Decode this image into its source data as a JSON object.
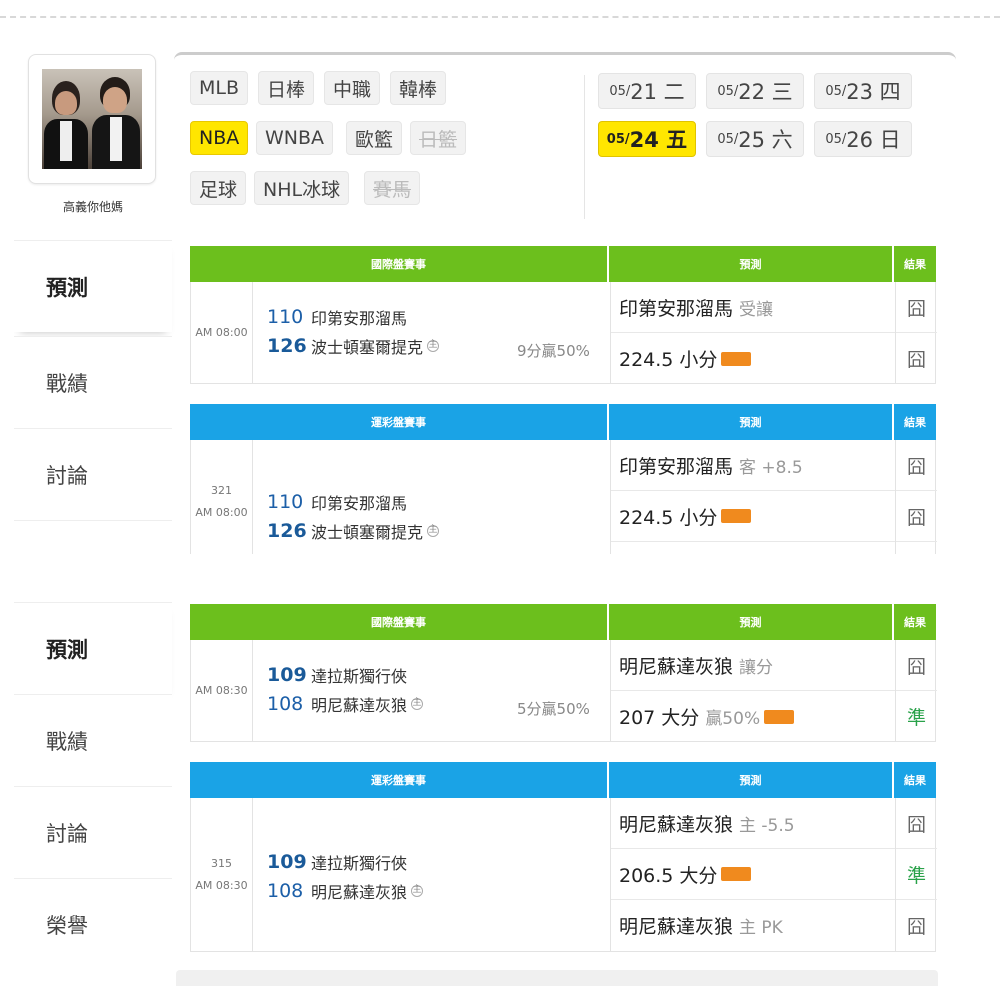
{
  "user": {
    "name": "高義你他媽"
  },
  "nav": {
    "top": [
      {
        "label": "預測",
        "active": true
      },
      {
        "label": "戰績",
        "active": false
      },
      {
        "label": "討論",
        "active": false
      }
    ],
    "bottom": [
      {
        "label": "預測",
        "active": true
      },
      {
        "label": "戰績",
        "active": false
      },
      {
        "label": "討論",
        "active": false
      },
      {
        "label": "榮譽",
        "active": false
      }
    ]
  },
  "leagues": [
    {
      "label": "MLB",
      "state": "normal"
    },
    {
      "label": "日棒",
      "state": "normal"
    },
    {
      "label": "中職",
      "state": "normal"
    },
    {
      "label": "韓棒",
      "state": "normal"
    },
    {
      "label": "NBA",
      "state": "active"
    },
    {
      "label": "WNBA",
      "state": "normal"
    },
    {
      "label": "歐籃",
      "state": "normal"
    },
    {
      "label": "日籃",
      "state": "disabled"
    },
    {
      "label": "足球",
      "state": "normal"
    },
    {
      "label": "NHL冰球",
      "state": "normal"
    },
    {
      "label": "賽馬",
      "state": "disabled"
    }
  ],
  "dates": [
    {
      "md": "05/",
      "d": "21 二"
    },
    {
      "md": "05/",
      "d": "22 三"
    },
    {
      "md": "05/",
      "d": "23 四"
    },
    {
      "md": "05/",
      "d": "24 五",
      "active": true
    },
    {
      "md": "05/",
      "d": "25 六"
    },
    {
      "md": "05/",
      "d": "26 日"
    }
  ],
  "headers": {
    "intl": "國際盤賽事",
    "sport": "運彩盤賽事",
    "pred": "預測",
    "result": "結果"
  },
  "games": [
    {
      "time": "AM 08:00",
      "num": "",
      "away": {
        "score": "110",
        "team": "印第安那溜馬",
        "win": false
      },
      "home": {
        "score": "126",
        "team": "波士頓塞爾提克",
        "win": true,
        "mark": "主"
      },
      "margin": "9分贏50%",
      "preds": [
        {
          "main": "印第安那溜馬",
          "sub": "受讓",
          "tag": false
        },
        {
          "main": "224.5 小分",
          "sub": "",
          "tag": true
        }
      ],
      "results": [
        {
          "text": "囧",
          "hit": false
        },
        {
          "text": "囧",
          "hit": false
        }
      ]
    },
    {
      "time": "AM 08:00",
      "num": "321",
      "away": {
        "score": "110",
        "team": "印第安那溜馬",
        "win": false
      },
      "home": {
        "score": "126",
        "team": "波士頓塞爾提克",
        "win": true,
        "mark": "主"
      },
      "margin": "",
      "preds": [
        {
          "main": "印第安那溜馬",
          "sub": "客 +8.5",
          "tag": false
        },
        {
          "main": "224.5 小分",
          "sub": "",
          "tag": true
        }
      ],
      "results": [
        {
          "text": "囧",
          "hit": false
        },
        {
          "text": "囧",
          "hit": false
        }
      ]
    },
    {
      "time": "AM 08:30",
      "num": "",
      "away": {
        "score": "109",
        "team": "達拉斯獨行俠",
        "win": true
      },
      "home": {
        "score": "108",
        "team": "明尼蘇達灰狼",
        "win": false,
        "mark": "主"
      },
      "margin": "5分贏50%",
      "preds": [
        {
          "main": "明尼蘇達灰狼",
          "sub": "讓分",
          "tag": false
        },
        {
          "main": "207 大分",
          "sub": "贏50%",
          "tag": true
        }
      ],
      "results": [
        {
          "text": "囧",
          "hit": false
        },
        {
          "text": "準",
          "hit": true
        }
      ]
    },
    {
      "time": "AM 08:30",
      "num": "315",
      "away": {
        "score": "109",
        "team": "達拉斯獨行俠",
        "win": true
      },
      "home": {
        "score": "108",
        "team": "明尼蘇達灰狼",
        "win": false,
        "mark": "主"
      },
      "margin": "",
      "preds": [
        {
          "main": "明尼蘇達灰狼",
          "sub": "主 -5.5",
          "tag": false
        },
        {
          "main": "206.5 大分",
          "sub": "",
          "tag": true
        },
        {
          "main": "明尼蘇達灰狼",
          "sub": "主 PK",
          "tag": false
        }
      ],
      "results": [
        {
          "text": "囧",
          "hit": false
        },
        {
          "text": "準",
          "hit": true
        },
        {
          "text": "囧",
          "hit": false
        }
      ]
    }
  ]
}
